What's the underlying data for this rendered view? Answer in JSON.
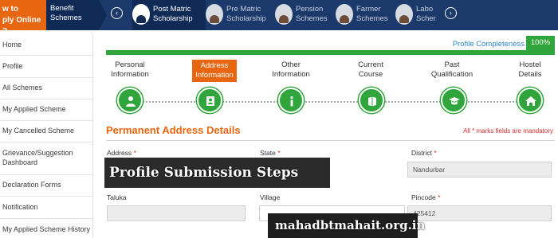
{
  "topbar": {
    "howto_line1": "w to",
    "howto_line2": "ply Online ?",
    "benefit_line1": "Benefit",
    "benefit_line2": "Schemes",
    "prev_icon": "‹",
    "next_icon": "›",
    "tabs": [
      {
        "line1": "Post Matric",
        "line2": "Scholarship",
        "active": true
      },
      {
        "line1": "Pre Matric",
        "line2": "Scholarship",
        "active": false
      },
      {
        "line1": "Pension",
        "line2": "Schemes",
        "active": false
      },
      {
        "line1": "Farmer",
        "line2": "Schemes",
        "active": false
      },
      {
        "line1": "Labo",
        "line2": "Scher",
        "active": false
      }
    ]
  },
  "sidebar": {
    "items": [
      {
        "label": "Home"
      },
      {
        "label": "Profile"
      },
      {
        "label": "All Schemes"
      },
      {
        "label": "My Applied Scheme"
      },
      {
        "label": "My Cancelled Scheme"
      },
      {
        "label": "Grievance/Suggestion Dashboard"
      },
      {
        "label": "Declaration Forms"
      },
      {
        "label": "Notification"
      },
      {
        "label": "My Applied Scheme History"
      }
    ]
  },
  "profile": {
    "completeness_label": "Profile Completeness",
    "completeness_value": "100%",
    "completeness_fraction": 1.0,
    "steps": [
      {
        "line1": "Personal",
        "line2": "Information",
        "icon": "user-icon",
        "active": false
      },
      {
        "line1": "Address",
        "line2": "Information",
        "icon": "address-book-icon",
        "active": true
      },
      {
        "line1": "Other",
        "line2": "Information",
        "icon": "info-icon",
        "active": false
      },
      {
        "line1": "Current",
        "line2": "Course",
        "icon": "book-icon",
        "active": false
      },
      {
        "line1": "Past",
        "line2": "Qualification",
        "icon": "graduation-cap-icon",
        "active": false
      },
      {
        "line1": "Hostel",
        "line2": "Details",
        "icon": "home-icon",
        "active": false
      }
    ]
  },
  "form": {
    "section_title": "Permanent Address Details",
    "mandatory_note": "All * marks fields are mandatory",
    "req_mark": "*",
    "fields": {
      "address": {
        "label": "Address",
        "value": "",
        "required": true
      },
      "state": {
        "label": "State",
        "value": "",
        "required": true
      },
      "district": {
        "label": "District",
        "value": "Nandurbar",
        "required": true
      },
      "taluka": {
        "label": "Taluka",
        "value": "",
        "required": false
      },
      "village": {
        "label": "Village",
        "value": "",
        "required": false
      },
      "pincode": {
        "label": "Pincode",
        "value": "425412",
        "required": true
      }
    }
  },
  "overlay": {
    "steps_banner": "Profile Submission Steps",
    "site_banner": "mahadbtmahait.org.in"
  },
  "colors": {
    "nav_bg": "#1b3a6b",
    "accent_orange": "#e8660f",
    "success_green": "#2fa53b",
    "link_blue": "#2d86c9",
    "required_red": "#d9302c"
  }
}
